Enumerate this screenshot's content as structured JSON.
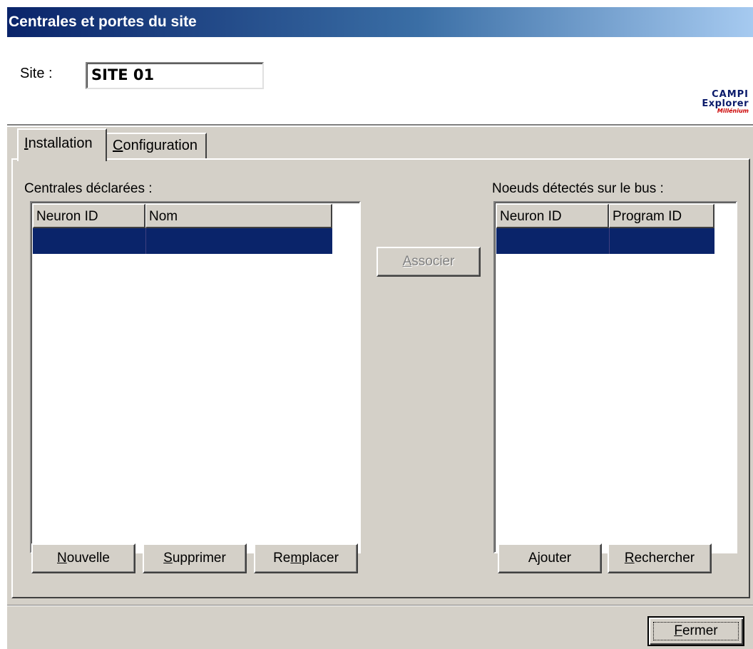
{
  "window": {
    "title": "Centrales et portes du site"
  },
  "site": {
    "label": "Site :",
    "value": "SITE 01"
  },
  "logo": {
    "line1": "CAMPI",
    "line2": "Explorer",
    "line3": "Millénium"
  },
  "tabs": [
    {
      "label": "Installation",
      "accel": "I",
      "rest": "nstallation",
      "active": true
    },
    {
      "label": "Configuration",
      "accel": "C",
      "rest": "onfiguration",
      "active": false
    }
  ],
  "declared": {
    "label": "Centrales déclarées :",
    "columns": [
      "Neuron ID",
      "Nom"
    ],
    "rows": [
      {
        "neuron_id": "",
        "nom": "",
        "selected": true
      }
    ]
  },
  "detected": {
    "label": "Noeuds détectés sur le bus :",
    "columns": [
      "Neuron ID",
      "Program ID"
    ],
    "rows": [
      {
        "neuron_id": "",
        "program_id": "",
        "selected": true
      }
    ]
  },
  "buttons": {
    "associer": {
      "label": "Associer",
      "accel": "A",
      "rest": "ssocier",
      "enabled": false
    },
    "nouvelle": {
      "label": "Nouvelle",
      "accel": "N",
      "rest": "ouvelle"
    },
    "supprimer": {
      "label": "Supprimer",
      "accel": "S",
      "rest": "upprimer"
    },
    "remplacer": {
      "label": "Remplacer",
      "pre": "Re",
      "accel": "m",
      "rest": "placer"
    },
    "ajouter": {
      "label": "Ajouter"
    },
    "rechercher": {
      "label": "Rechercher",
      "accel": "R",
      "rest": "echercher"
    },
    "fermer": {
      "label": "Fermer",
      "accel": "F",
      "rest": "ermer"
    }
  },
  "colors": {
    "selection": "#0a246a",
    "face": "#d4d0c8",
    "title_start": "#0a246a",
    "title_end": "#a6caf0"
  }
}
